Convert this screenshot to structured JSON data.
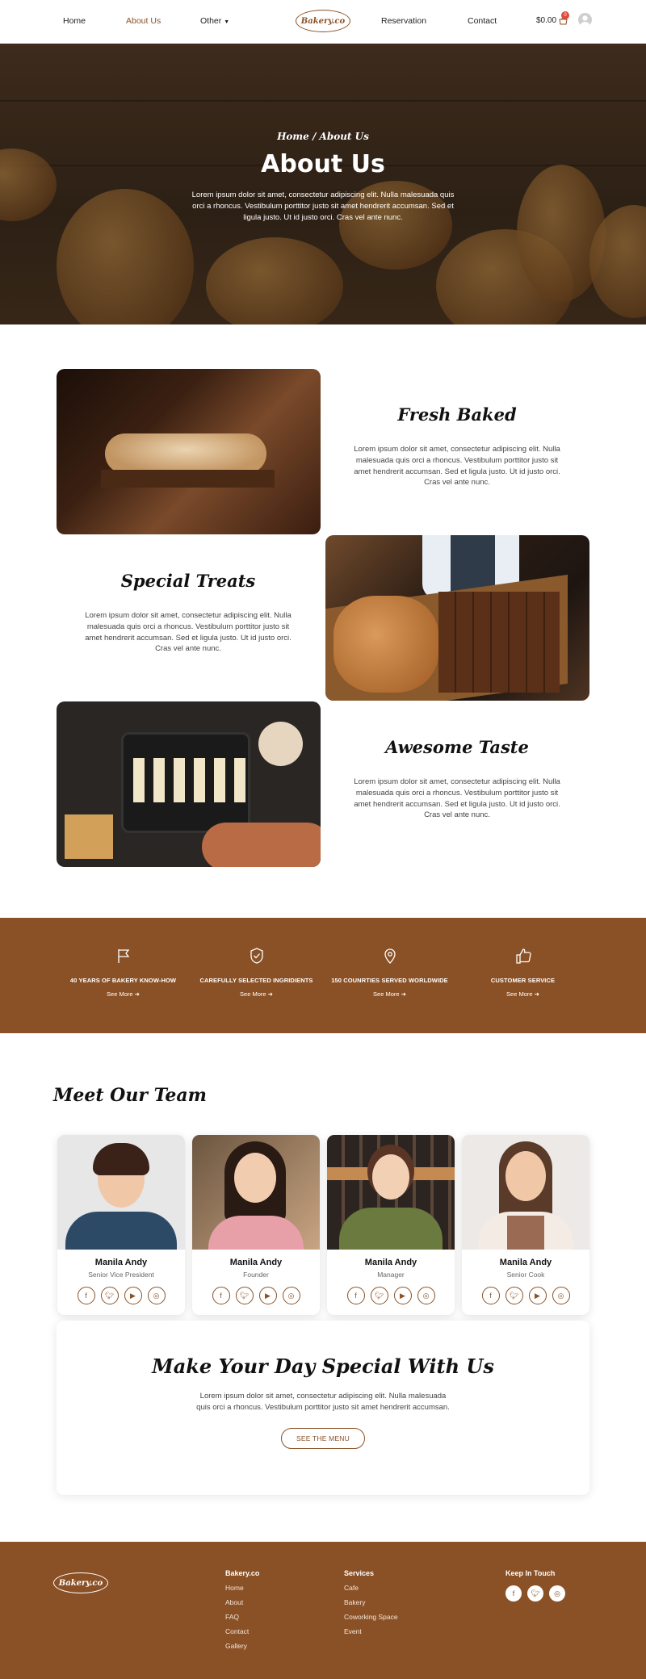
{
  "nav": {
    "items": [
      "Home",
      "About Us",
      "Other",
      "Reservation",
      "Contact"
    ],
    "logo": "Bakery.co",
    "cart_total": "$0.00",
    "cart_count": "0"
  },
  "hero": {
    "breadcrumb": "Home / About Us",
    "title": "About Us",
    "text": "Lorem ipsum dolor sit amet, consectetur adipiscing elit. Nulla malesuada quis orci a rhoncus. Vestibulum porttitor justo sit amet hendrerit accumsan. Sed et ligula justo. Ut id justo orci. Cras vel ante nunc."
  },
  "features": [
    {
      "title": "Fresh Baked",
      "text": "Lorem ipsum dolor sit amet, consectetur adipiscing elit. Nulla malesuada quis orci a rhoncus. Vestibulum porttitor justo sit amet hendrerit accumsan. Sed et ligula justo. Ut id justo orci. Cras vel ante nunc."
    },
    {
      "title": "Special Treats",
      "text": "Lorem ipsum dolor sit amet, consectetur adipiscing elit. Nulla malesuada quis orci a rhoncus. Vestibulum porttitor justo sit amet hendrerit accumsan. Sed et ligula justo. Ut id justo orci. Cras vel ante nunc."
    },
    {
      "title": "Awesome Taste",
      "text": "Lorem ipsum dolor sit amet, consectetur adipiscing elit. Nulla malesuada quis orci a rhoncus. Vestibulum porttitor justo sit amet hendrerit accumsan. Sed et ligula justo. Ut id justo orci. Cras vel ante nunc."
    }
  ],
  "band": {
    "items": [
      {
        "title": "40 YEARS OF BAKERY KNOW-HOW",
        "link": "See More",
        "icon": "flag-icon"
      },
      {
        "title": "CAREFULLY SELECTED INGRIDIENTS",
        "link": "See More",
        "icon": "shield-check-icon"
      },
      {
        "title": "150 COUNRTIES SERVED WORLDWIDE",
        "link": "See More",
        "icon": "location-pin-icon"
      },
      {
        "title": "CUSTOMER SERVICE",
        "link": "See More",
        "icon": "thumbs-up-icon"
      }
    ]
  },
  "team": {
    "title": "Meet Our Team",
    "members": [
      {
        "name": "Manila Andy",
        "role": "Senior Vice President"
      },
      {
        "name": "Manila Andy",
        "role": "Founder"
      },
      {
        "name": "Manila Andy",
        "role": "Manager"
      },
      {
        "name": "Manila Andy",
        "role": "Senior Cook"
      }
    ]
  },
  "special": {
    "title": "Make Your Day Special With Us",
    "text": "Lorem ipsum dolor sit amet, consectetur adipiscing elit. Nulla malesuada quis orci a rhoncus. Vestibulum porttitor justo sit amet hendrerit accumsan.",
    "button": "SEE THE MENU"
  },
  "footer": {
    "logo": "Bakery.co",
    "col1": {
      "title": "Bakery.co",
      "links": [
        "Home",
        "About",
        "FAQ",
        "Contact",
        "Gallery"
      ]
    },
    "col2": {
      "title": "Services",
      "links": [
        "Cafe",
        "Bakery",
        "Coworking Space",
        "Event"
      ]
    },
    "col3": {
      "title": "Keep In Touch"
    }
  },
  "colors": {
    "brand": "#8b5126",
    "text": "#333333"
  }
}
